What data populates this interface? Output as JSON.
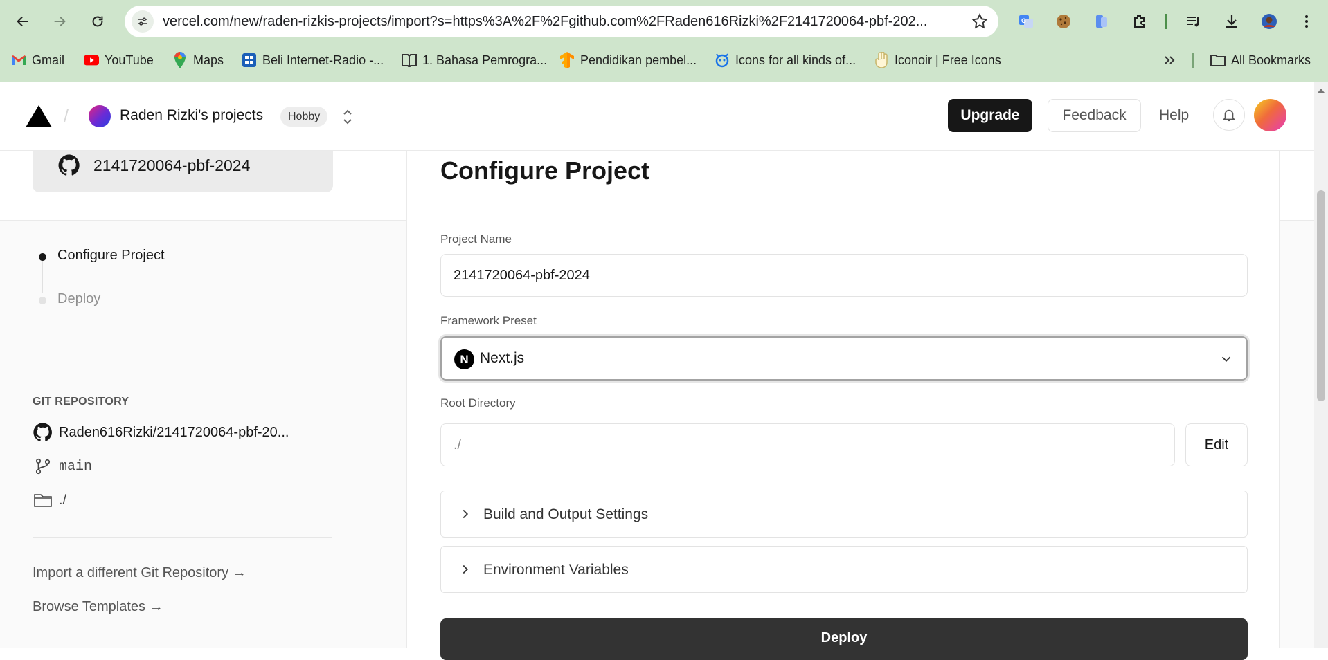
{
  "browser": {
    "url": "vercel.com/new/raden-rizkis-projects/import?s=https%3A%2F%2Fgithub.com%2FRaden616Rizki%2F2141720064-pbf-202...",
    "bookmarks": [
      {
        "label": "Gmail",
        "icon": "gmail-icon"
      },
      {
        "label": "YouTube",
        "icon": "youtube-icon"
      },
      {
        "label": "Maps",
        "icon": "maps-icon"
      },
      {
        "label": "Beli Internet-Radio -...",
        "icon": "store-icon"
      },
      {
        "label": "1. Bahasa Pemrogra...",
        "icon": "book-icon"
      },
      {
        "label": "Pendidikan pembel...",
        "icon": "tensorflow-icon"
      },
      {
        "label": "Icons for all kinds of...",
        "icon": "icon-site-icon"
      },
      {
        "label": "Iconoir | Free Icons",
        "icon": "hand-icon"
      }
    ],
    "all_bookmarks_label": "All Bookmarks"
  },
  "header": {
    "team_name": "Raden Rizki's projects",
    "plan_badge": "Hobby",
    "upgrade_label": "Upgrade",
    "feedback_label": "Feedback",
    "help_label": "Help"
  },
  "repo_card": {
    "title": "2141720064-pbf-2024"
  },
  "steps": [
    {
      "label": "Configure Project",
      "active": true
    },
    {
      "label": "Deploy",
      "active": false
    }
  ],
  "git": {
    "heading": "GIT REPOSITORY",
    "repo": "Raden616Rizki/2141720064-pbf-20...",
    "branch": "main",
    "directory": "./"
  },
  "links": {
    "import_other": "Import a different Git Repository →",
    "browse_templates": "Browse Templates →"
  },
  "configure": {
    "title": "Configure Project",
    "project_name_label": "Project Name",
    "project_name_value": "2141720064-pbf-2024",
    "framework_label": "Framework Preset",
    "framework_value": "Next.js",
    "framework_icon_letter": "N",
    "root_label": "Root Directory",
    "root_value": "./",
    "edit_label": "Edit",
    "build_settings_label": "Build and Output Settings",
    "env_vars_label": "Environment Variables",
    "deploy_label": "Deploy"
  },
  "colors": {
    "chrome_bg": "#cfe5cc",
    "primary_button": "#171717",
    "deploy_button": "#333333"
  }
}
